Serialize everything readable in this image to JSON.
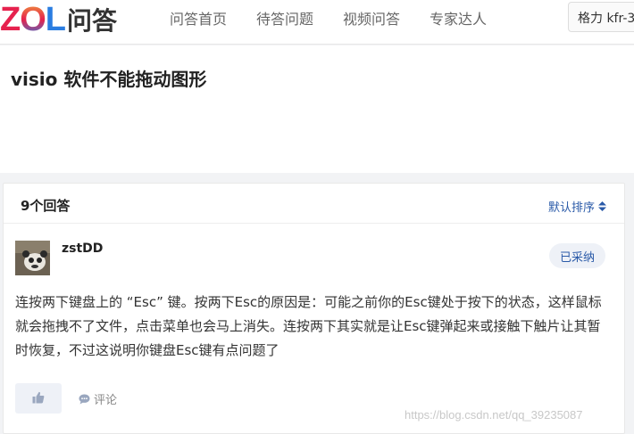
{
  "logo": {
    "brand": "ZOL",
    "suffix": "问答"
  },
  "nav": {
    "items": [
      {
        "label": "问答首页"
      },
      {
        "label": "待答问题"
      },
      {
        "label": "视频问答"
      },
      {
        "label": "专家达人"
      }
    ]
  },
  "search": {
    "value": "格力 kfr-3"
  },
  "question": {
    "title": "visio 软件不能拖动图形"
  },
  "answers": {
    "count_label": "9个回答",
    "sort_label": "默认排序",
    "items": [
      {
        "username": "zstDD",
        "badge": "已采纳",
        "text": "连按两下键盘上的 “Esc” 键。按两下Esc的原因是：可能之前你的Esc键处于按下的状态，这样鼠标就会拖拽不了文件，点击菜单也会马上消失。连按两下其实就是让Esc键弹起来或接触下触片让其暂时恢复，不过这说明你键盘Esc键有点问题了",
        "comment_label": "评论"
      }
    ]
  },
  "watermark": "https://blog.csdn.net/qq_39235087",
  "colors": {
    "accent": "#2a5aa8",
    "badge_bg": "#eef1f7",
    "logo_red": "#e6224e",
    "logo_blue": "#2a7de1"
  }
}
